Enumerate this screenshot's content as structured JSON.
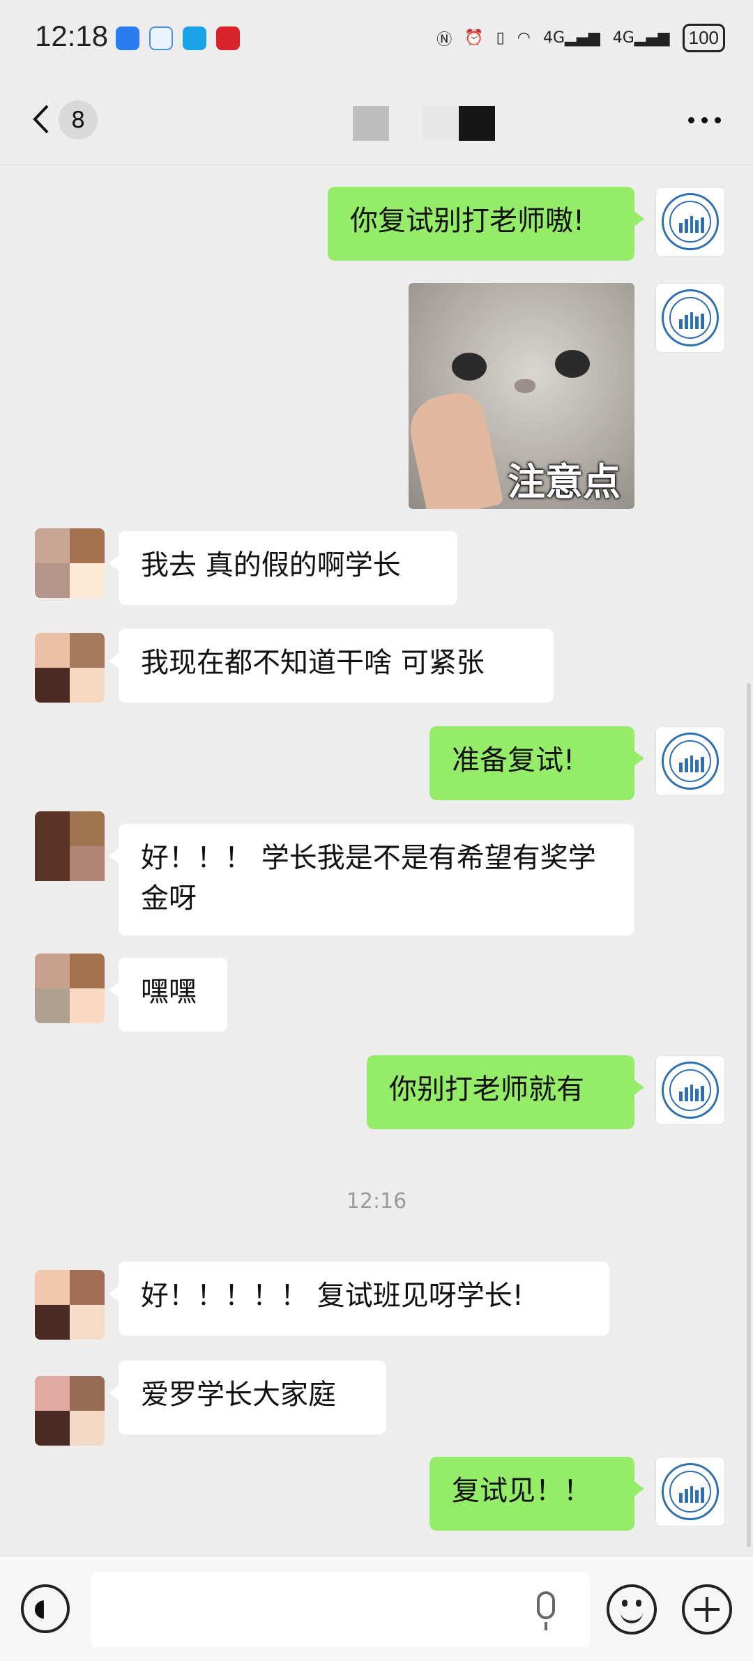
{
  "status_bar": {
    "time": "12:18",
    "battery": "100",
    "network_labels": [
      "4G",
      "4G"
    ]
  },
  "nav": {
    "unread_count": "8",
    "more_label": "…"
  },
  "messages": [
    {
      "id": 1,
      "sender": "me",
      "text": "你复试别打老师嗷!"
    },
    {
      "id": 2,
      "sender": "me",
      "type": "sticker",
      "caption": "注意点"
    },
    {
      "id": 3,
      "sender": "them",
      "text": "我去 真的假的啊学长"
    },
    {
      "id": 4,
      "sender": "them",
      "text": "我现在都不知道干啥 可紧张"
    },
    {
      "id": 5,
      "sender": "me",
      "text": "准备复试!"
    },
    {
      "id": 6,
      "sender": "them",
      "text": "好！！！ 学长我是不是有希望有奖学金呀"
    },
    {
      "id": 7,
      "sender": "them",
      "text": "嘿嘿"
    },
    {
      "id": 8,
      "sender": "me",
      "text": "你别打老师就有"
    },
    {
      "id": 9,
      "sender": "them",
      "text": "好！！！！！ 复试班见呀学长!"
    },
    {
      "id": 10,
      "sender": "them",
      "text": "爱罗学长大家庭"
    },
    {
      "id": 11,
      "sender": "me",
      "text": "复试见！！"
    }
  ],
  "timestamp": "12:16",
  "colors": {
    "my_bubble": "#95ec69",
    "their_bubble": "#ffffff",
    "background": "#ededed",
    "seal_blue": "#2d6fb0"
  },
  "icons": [
    "back-icon",
    "more-icon",
    "voice-icon",
    "mic-icon",
    "emoji-icon",
    "plus-icon"
  ],
  "input": {
    "value": ""
  }
}
